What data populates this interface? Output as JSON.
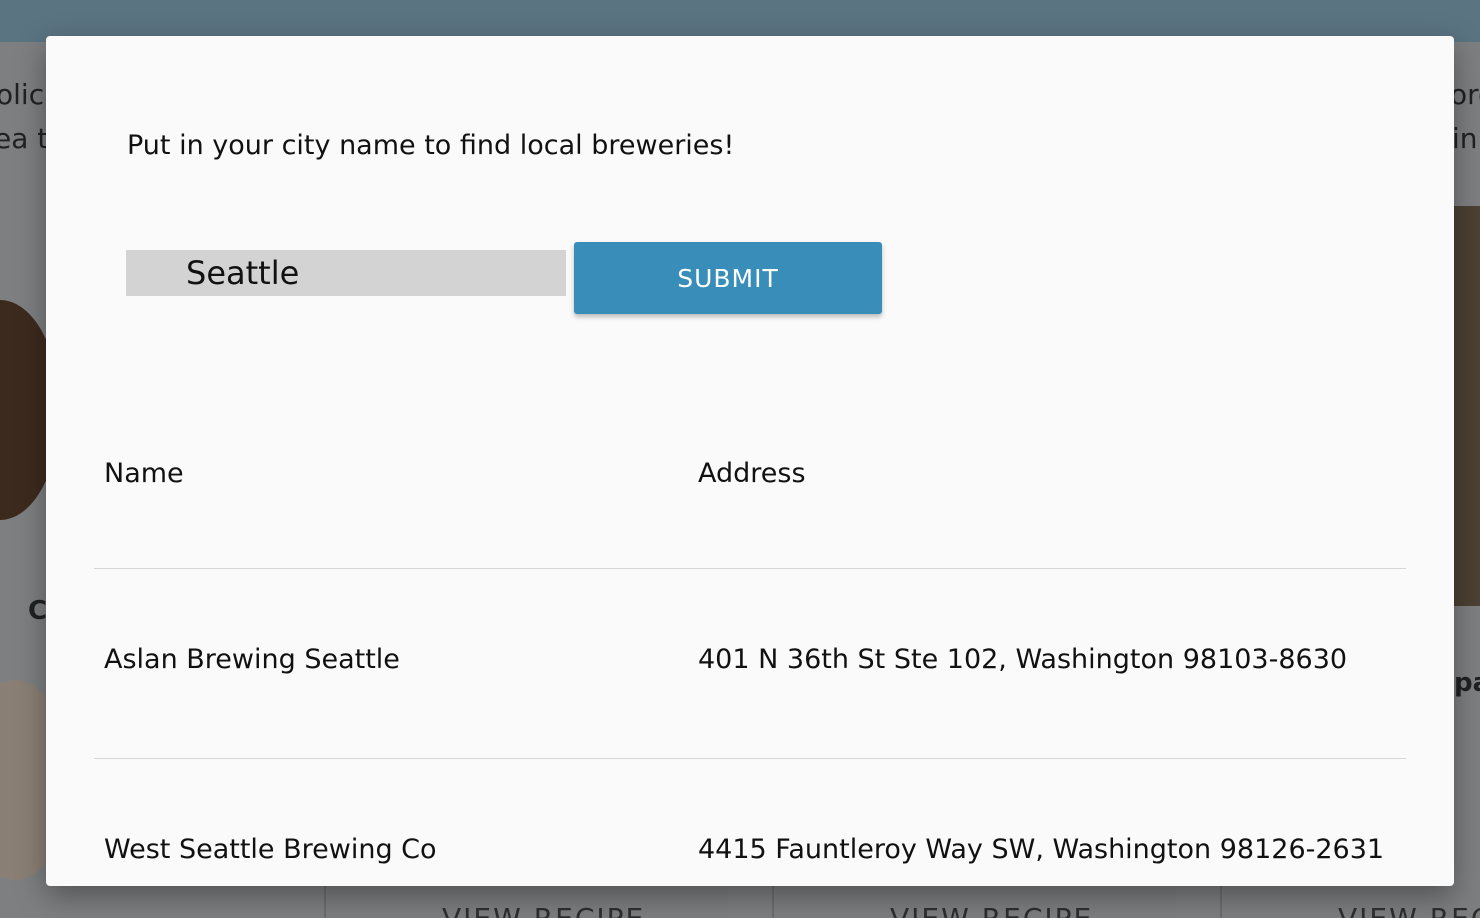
{
  "background": {
    "left_text": [
      "olica",
      "ea to"
    ],
    "right_text": [
      "ore",
      "in"
    ],
    "left_heading": "Cl",
    "right_heading": "pa",
    "card_label": "VIEW RECIPE"
  },
  "modal": {
    "prompt": "Put in your city name to find local breweries!",
    "city_input": {
      "value": "Seattle",
      "placeholder": ""
    },
    "submit_label": "SUBMIT",
    "table": {
      "headers": {
        "name": "Name",
        "address": "Address"
      },
      "rows": [
        {
          "name": "Aslan Brewing Seattle",
          "address": "401 N 36th St Ste 102, Washington 98103-8630"
        },
        {
          "name": "West Seattle Brewing Co",
          "address": "4415 Fauntleroy Way SW, Washington 98126-2631"
        }
      ]
    }
  },
  "colors": {
    "topbar": "#5b7482",
    "submit_button": "#388eb8",
    "input_background": "#d3d3d3",
    "modal_background": "#fafafa"
  }
}
